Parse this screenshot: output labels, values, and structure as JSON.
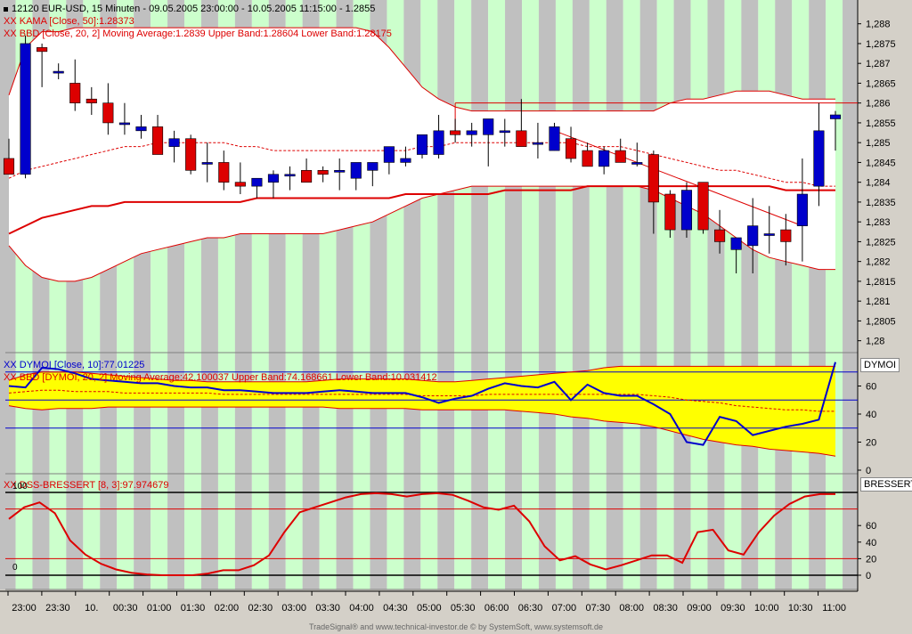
{
  "header": {
    "title": "12120  EUR-USD, 15 Minuten - 09.05.2005 23:00:00 - 10.05.2005 11:15:00 - 1.2855",
    "kama": "KAMA [Close, 50]:1.28373",
    "bbd": "BBD [Close, 20, 2] Moving Average:1.2839 Upper Band:1.28604 Lower Band:1.28175",
    "marker": "XX"
  },
  "indicator1": {
    "dymoi": "DYMOI [Close, 10]:77.01225",
    "bbd": "BBD [DYMOI, 20, 2] Moving Average:42.100037 Upper Band:74.168661 Lower Band:10.031412",
    "tag": "DYMOI"
  },
  "indicator2": {
    "stoch": "DSS-BRESSERT [8, 3]:97.974679",
    "tag": "BRESSERT",
    "level_100": "100",
    "level_0": "0"
  },
  "footer": "TradeSignal® and www.technical-investor.de © by  SystemSoft, www.systemsoft.de",
  "colors": {
    "up": "#0000cc",
    "down": "#dd0000",
    "band": "#dd0000",
    "dymoi": "#0000cc",
    "dymoi_band_fill": "#ffff00",
    "stoch": "#dd0000",
    "stripe_green": "#ccffcc",
    "stripe_gray": "#c0c0c0"
  },
  "chart_data": [
    {
      "type": "candlestick",
      "title": "12120  EUR-USD, 15 Minuten - 09.05.2005 23:00:00 - 10.05.2005 11:15:00 - 1.2855",
      "x_ticks": [
        "23:00",
        "23:30",
        "10.",
        "00:30",
        "01:00",
        "01:30",
        "02:00",
        "02:30",
        "03:00",
        "03:30",
        "04:00",
        "04:30",
        "05:00",
        "05:30",
        "06:00",
        "06:30",
        "07:00",
        "07:30",
        "08:00",
        "08:30",
        "09:00",
        "09:30",
        "10:00",
        "10:30",
        "11:00"
      ],
      "y_ticks": [
        "1,288",
        "1,2875",
        "1,287",
        "1,2865",
        "1,286",
        "1,2855",
        "1,285",
        "1,2845",
        "1,284",
        "1,2835",
        "1,283",
        "1,2825",
        "1,282",
        "1,2815",
        "1,281",
        "1,2805",
        "1,28"
      ],
      "ylim": [
        1.2797,
        1.2886
      ],
      "candles": [
        {
          "o": 1.2846,
          "h": 1.2851,
          "l": 1.2842,
          "c": 1.2842
        },
        {
          "o": 1.2842,
          "h": 1.2877,
          "l": 1.2841,
          "c": 1.2875
        },
        {
          "o": 1.2874,
          "h": 1.2875,
          "l": 1.2864,
          "c": 1.2873
        },
        {
          "o": 1.2868,
          "h": 1.287,
          "l": 1.2866,
          "c": 1.2868
        },
        {
          "o": 1.2865,
          "h": 1.2871,
          "l": 1.2858,
          "c": 1.286
        },
        {
          "o": 1.2861,
          "h": 1.2864,
          "l": 1.2857,
          "c": 1.286
        },
        {
          "o": 1.286,
          "h": 1.2865,
          "l": 1.2852,
          "c": 1.2855
        },
        {
          "o": 1.2855,
          "h": 1.286,
          "l": 1.2852,
          "c": 1.2855
        },
        {
          "o": 1.2853,
          "h": 1.2857,
          "l": 1.2851,
          "c": 1.2854
        },
        {
          "o": 1.2854,
          "h": 1.2857,
          "l": 1.2847,
          "c": 1.2847
        },
        {
          "o": 1.2849,
          "h": 1.2853,
          "l": 1.2845,
          "c": 1.2851
        },
        {
          "o": 1.2851,
          "h": 1.2852,
          "l": 1.2842,
          "c": 1.2843
        },
        {
          "o": 1.2845,
          "h": 1.285,
          "l": 1.284,
          "c": 1.2845
        },
        {
          "o": 1.2845,
          "h": 1.2848,
          "l": 1.2838,
          "c": 1.284
        },
        {
          "o": 1.284,
          "h": 1.2845,
          "l": 1.2837,
          "c": 1.2839
        },
        {
          "o": 1.2839,
          "h": 1.2841,
          "l": 1.2836,
          "c": 1.2841
        },
        {
          "o": 1.284,
          "h": 1.2843,
          "l": 1.2836,
          "c": 1.2842
        },
        {
          "o": 1.2842,
          "h": 1.2844,
          "l": 1.2838,
          "c": 1.2842
        },
        {
          "o": 1.2843,
          "h": 1.2846,
          "l": 1.284,
          "c": 1.284
        },
        {
          "o": 1.2843,
          "h": 1.2844,
          "l": 1.284,
          "c": 1.2842
        },
        {
          "o": 1.2843,
          "h": 1.2846,
          "l": 1.2838,
          "c": 1.2843
        },
        {
          "o": 1.2841,
          "h": 1.2843,
          "l": 1.2838,
          "c": 1.2845
        },
        {
          "o": 1.2843,
          "h": 1.2845,
          "l": 1.2839,
          "c": 1.2845
        },
        {
          "o": 1.2845,
          "h": 1.2849,
          "l": 1.2842,
          "c": 1.2849
        },
        {
          "o": 1.2845,
          "h": 1.2849,
          "l": 1.2844,
          "c": 1.2846
        },
        {
          "o": 1.2847,
          "h": 1.2852,
          "l": 1.2846,
          "c": 1.2852
        },
        {
          "o": 1.2847,
          "h": 1.2857,
          "l": 1.2846,
          "c": 1.2853
        },
        {
          "o": 1.2853,
          "h": 1.2856,
          "l": 1.285,
          "c": 1.2852
        },
        {
          "o": 1.2852,
          "h": 1.2855,
          "l": 1.2849,
          "c": 1.2853
        },
        {
          "o": 1.2852,
          "h": 1.2856,
          "l": 1.2844,
          "c": 1.2856
        },
        {
          "o": 1.2853,
          "h": 1.2856,
          "l": 1.2849,
          "c": 1.2853
        },
        {
          "o": 1.2853,
          "h": 1.2861,
          "l": 1.285,
          "c": 1.2849
        },
        {
          "o": 1.285,
          "h": 1.2855,
          "l": 1.2846,
          "c": 1.285
        },
        {
          "o": 1.2848,
          "h": 1.2855,
          "l": 1.2848,
          "c": 1.2854
        },
        {
          "o": 1.2851,
          "h": 1.2854,
          "l": 1.2845,
          "c": 1.2846
        },
        {
          "o": 1.2848,
          "h": 1.285,
          "l": 1.2844,
          "c": 1.2844
        },
        {
          "o": 1.2844,
          "h": 1.2849,
          "l": 1.2842,
          "c": 1.2848
        },
        {
          "o": 1.2848,
          "h": 1.2851,
          "l": 1.2845,
          "c": 1.2845
        },
        {
          "o": 1.2845,
          "h": 1.285,
          "l": 1.2844,
          "c": 1.2845
        },
        {
          "o": 1.2847,
          "h": 1.2848,
          "l": 1.2827,
          "c": 1.2835
        },
        {
          "o": 1.2837,
          "h": 1.2838,
          "l": 1.2826,
          "c": 1.2828
        },
        {
          "o": 1.2828,
          "h": 1.284,
          "l": 1.2826,
          "c": 1.2838
        },
        {
          "o": 1.284,
          "h": 1.284,
          "l": 1.2827,
          "c": 1.2828
        },
        {
          "o": 1.2828,
          "h": 1.2833,
          "l": 1.2822,
          "c": 1.2825
        },
        {
          "o": 1.2823,
          "h": 1.2826,
          "l": 1.2817,
          "c": 1.2826
        },
        {
          "o": 1.2824,
          "h": 1.2836,
          "l": 1.2817,
          "c": 1.2829
        },
        {
          "o": 1.2827,
          "h": 1.2834,
          "l": 1.2822,
          "c": 1.2827
        },
        {
          "o": 1.2828,
          "h": 1.2832,
          "l": 1.2819,
          "c": 1.2825
        },
        {
          "o": 1.2829,
          "h": 1.2846,
          "l": 1.282,
          "c": 1.2837
        },
        {
          "o": 1.2839,
          "h": 1.286,
          "l": 1.2834,
          "c": 1.2853
        },
        {
          "o": 1.2856,
          "h": 1.2858,
          "l": 1.2848,
          "c": 1.2857
        }
      ],
      "bands": {
        "upper": [
          1.2862,
          1.2874,
          1.2878,
          1.2878,
          1.2879,
          1.2879,
          1.2879,
          1.2879,
          1.2879,
          1.2879,
          1.2879,
          1.2879,
          1.2879,
          1.2879,
          1.2879,
          1.2879,
          1.2879,
          1.2879,
          1.2879,
          1.2879,
          1.2879,
          1.2879,
          1.2878,
          1.2874,
          1.2869,
          1.2864,
          1.2861,
          1.2859,
          1.2858,
          1.2858,
          1.2858,
          1.2858,
          1.2858,
          1.2858,
          1.2858,
          1.2858,
          1.2858,
          1.2858,
          1.2858,
          1.2858,
          1.286,
          1.2861,
          1.2861,
          1.2862,
          1.2863,
          1.2863,
          1.2863,
          1.2862,
          1.2861,
          1.2861,
          1.2861
        ],
        "middle": [
          1.2841,
          1.2843,
          1.2844,
          1.2845,
          1.2846,
          1.2847,
          1.2848,
          1.2849,
          1.2849,
          1.285,
          1.285,
          1.285,
          1.285,
          1.285,
          1.2849,
          1.2849,
          1.2848,
          1.2848,
          1.2848,
          1.2848,
          1.2848,
          1.2848,
          1.2848,
          1.2848,
          1.2848,
          1.2849,
          1.2849,
          1.285,
          1.285,
          1.285,
          1.285,
          1.285,
          1.285,
          1.285,
          1.285,
          1.2849,
          1.2849,
          1.2849,
          1.2848,
          1.2847,
          1.2846,
          1.2845,
          1.2844,
          1.2843,
          1.2843,
          1.2842,
          1.2841,
          1.284,
          1.284,
          1.2839,
          1.2839
        ],
        "lower": [
          1.2824,
          1.2819,
          1.2816,
          1.2815,
          1.2815,
          1.2816,
          1.2818,
          1.282,
          1.2822,
          1.2823,
          1.2824,
          1.2825,
          1.2826,
          1.2826,
          1.2827,
          1.2827,
          1.2827,
          1.2827,
          1.2827,
          1.2827,
          1.2828,
          1.2829,
          1.283,
          1.2832,
          1.2834,
          1.2836,
          1.2837,
          1.2838,
          1.2839,
          1.2839,
          1.2839,
          1.2839,
          1.2839,
          1.2839,
          1.2839,
          1.2839,
          1.2839,
          1.2839,
          1.2839,
          1.2838,
          1.2836,
          1.2834,
          1.2832,
          1.2829,
          1.2826,
          1.2823,
          1.2821,
          1.282,
          1.2819,
          1.2818,
          1.2818
        ]
      },
      "kama": [
        1.2827,
        1.2829,
        1.2831,
        1.2832,
        1.2833,
        1.2834,
        1.2834,
        1.2835,
        1.2835,
        1.2835,
        1.2835,
        1.2835,
        1.2835,
        1.2835,
        1.2835,
        1.2836,
        1.2836,
        1.2836,
        1.2836,
        1.2836,
        1.2836,
        1.2836,
        1.2836,
        1.2836,
        1.2837,
        1.2837,
        1.2837,
        1.2837,
        1.2837,
        1.2837,
        1.2838,
        1.2838,
        1.2838,
        1.2838,
        1.2838,
        1.2839,
        1.2839,
        1.2839,
        1.2839,
        1.2839,
        1.2839,
        1.2839,
        1.2839,
        1.2839,
        1.2839,
        1.2839,
        1.2839,
        1.2838,
        1.2838,
        1.2838,
        1.2838
      ],
      "resistance": 1.286,
      "trendline": [
        [
          33,
          1.2853
        ],
        [
          48,
          1.2829
        ]
      ]
    },
    {
      "type": "line",
      "name": "DYMOI",
      "y_ticks": [
        "60",
        "40",
        "20",
        "0"
      ],
      "ylim": [
        0,
        80
      ],
      "levels": [
        70,
        50,
        30
      ],
      "series": [
        {
          "name": "DYMOI",
          "values": [
            60,
            59,
            73,
            72,
            69,
            65,
            64,
            63,
            62,
            62,
            60,
            59,
            59,
            57,
            57,
            56,
            55,
            55,
            55,
            56,
            57,
            56,
            55,
            55,
            55,
            52,
            48,
            51,
            53,
            58,
            62,
            60,
            59,
            63,
            50,
            61,
            55,
            53,
            53,
            47,
            40,
            20,
            18,
            38,
            35,
            25,
            28,
            31,
            33,
            36,
            77
          ]
        },
        {
          "name": "Upper Band",
          "values": [
            64,
            68,
            70,
            70,
            70,
            69,
            68,
            67,
            66,
            65,
            64,
            64,
            63,
            63,
            63,
            63,
            63,
            63,
            63,
            64,
            65,
            65,
            65,
            65,
            65,
            64,
            63,
            63,
            64,
            65,
            66,
            67,
            68,
            69,
            70,
            71,
            73,
            74,
            74,
            74,
            74,
            74,
            74,
            74,
            74,
            74,
            74,
            74,
            74,
            74,
            74
          ]
        },
        {
          "name": "Moving Average",
          "values": [
            55,
            56,
            57,
            57,
            56,
            56,
            56,
            55,
            55,
            55,
            55,
            55,
            55,
            54,
            54,
            54,
            54,
            54,
            54,
            54,
            54,
            54,
            54,
            54,
            54,
            53,
            53,
            53,
            53,
            54,
            54,
            54,
            54,
            54,
            54,
            54,
            54,
            54,
            54,
            53,
            52,
            50,
            49,
            48,
            46,
            45,
            44,
            43,
            43,
            42,
            42
          ]
        },
        {
          "name": "Lower Band",
          "values": [
            46,
            44,
            43,
            44,
            44,
            44,
            45,
            45,
            45,
            45,
            45,
            45,
            45,
            45,
            45,
            45,
            45,
            45,
            45,
            45,
            44,
            44,
            44,
            44,
            44,
            43,
            43,
            43,
            43,
            43,
            43,
            42,
            41,
            40,
            38,
            37,
            35,
            34,
            33,
            31,
            28,
            25,
            22,
            20,
            18,
            17,
            15,
            14,
            13,
            12,
            10
          ]
        }
      ]
    },
    {
      "type": "line",
      "name": "DSS-BRESSERT",
      "y_ticks": [
        "60",
        "40",
        "20",
        "0"
      ],
      "ylim": [
        0,
        100
      ],
      "levels": [
        100,
        80,
        20,
        0
      ],
      "series": [
        {
          "name": "DSS-BRESSERT",
          "values": [
            68,
            82,
            88,
            75,
            42,
            25,
            14,
            7,
            3,
            1,
            0,
            0,
            0,
            2,
            6,
            6,
            12,
            24,
            52,
            76,
            82,
            88,
            94,
            98,
            99,
            98,
            95,
            98,
            99,
            97,
            90,
            82,
            79,
            84,
            65,
            35,
            18,
            23,
            13,
            7,
            12,
            18,
            24,
            24,
            15,
            52,
            55,
            30,
            25,
            52,
            72,
            86,
            95,
            98,
            98
          ]
        }
      ]
    }
  ]
}
